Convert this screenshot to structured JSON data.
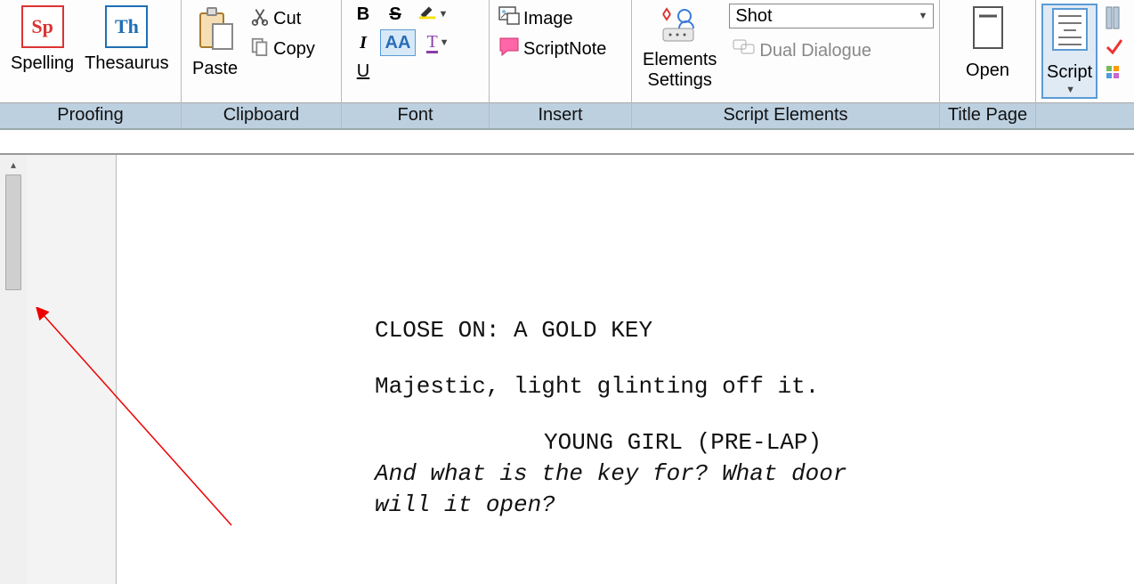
{
  "ribbon": {
    "proofing": {
      "label": "Proofing",
      "spelling": "Spelling",
      "thesaurus": "Thesaurus"
    },
    "clipboard": {
      "label": "Clipboard",
      "paste": "Paste",
      "cut": "Cut",
      "copy": "Copy"
    },
    "font": {
      "label": "Font",
      "bold": "B",
      "strike": "S",
      "italic": "I",
      "case": "AA",
      "underline": "U",
      "textcolor": "T"
    },
    "insert": {
      "label": "Insert",
      "image": "Image",
      "scriptnote": "ScriptNote"
    },
    "script_elements": {
      "label": "Script Elements",
      "elements_settings_line1": "Elements",
      "elements_settings_line2": "Settings",
      "combo_value": "Shot",
      "dual_dialogue": "Dual Dialogue"
    },
    "title_page": {
      "label": "Title Page",
      "open": "Open"
    },
    "script_group": {
      "script": "Script"
    }
  },
  "document": {
    "shot": "CLOSE ON: A GOLD KEY",
    "action": "Majestic, light glinting off it.",
    "character": "YOUNG GIRL (PRE-LAP)",
    "dialogue1": "And what is the key for? What door",
    "dialogue2": "will it open?"
  }
}
